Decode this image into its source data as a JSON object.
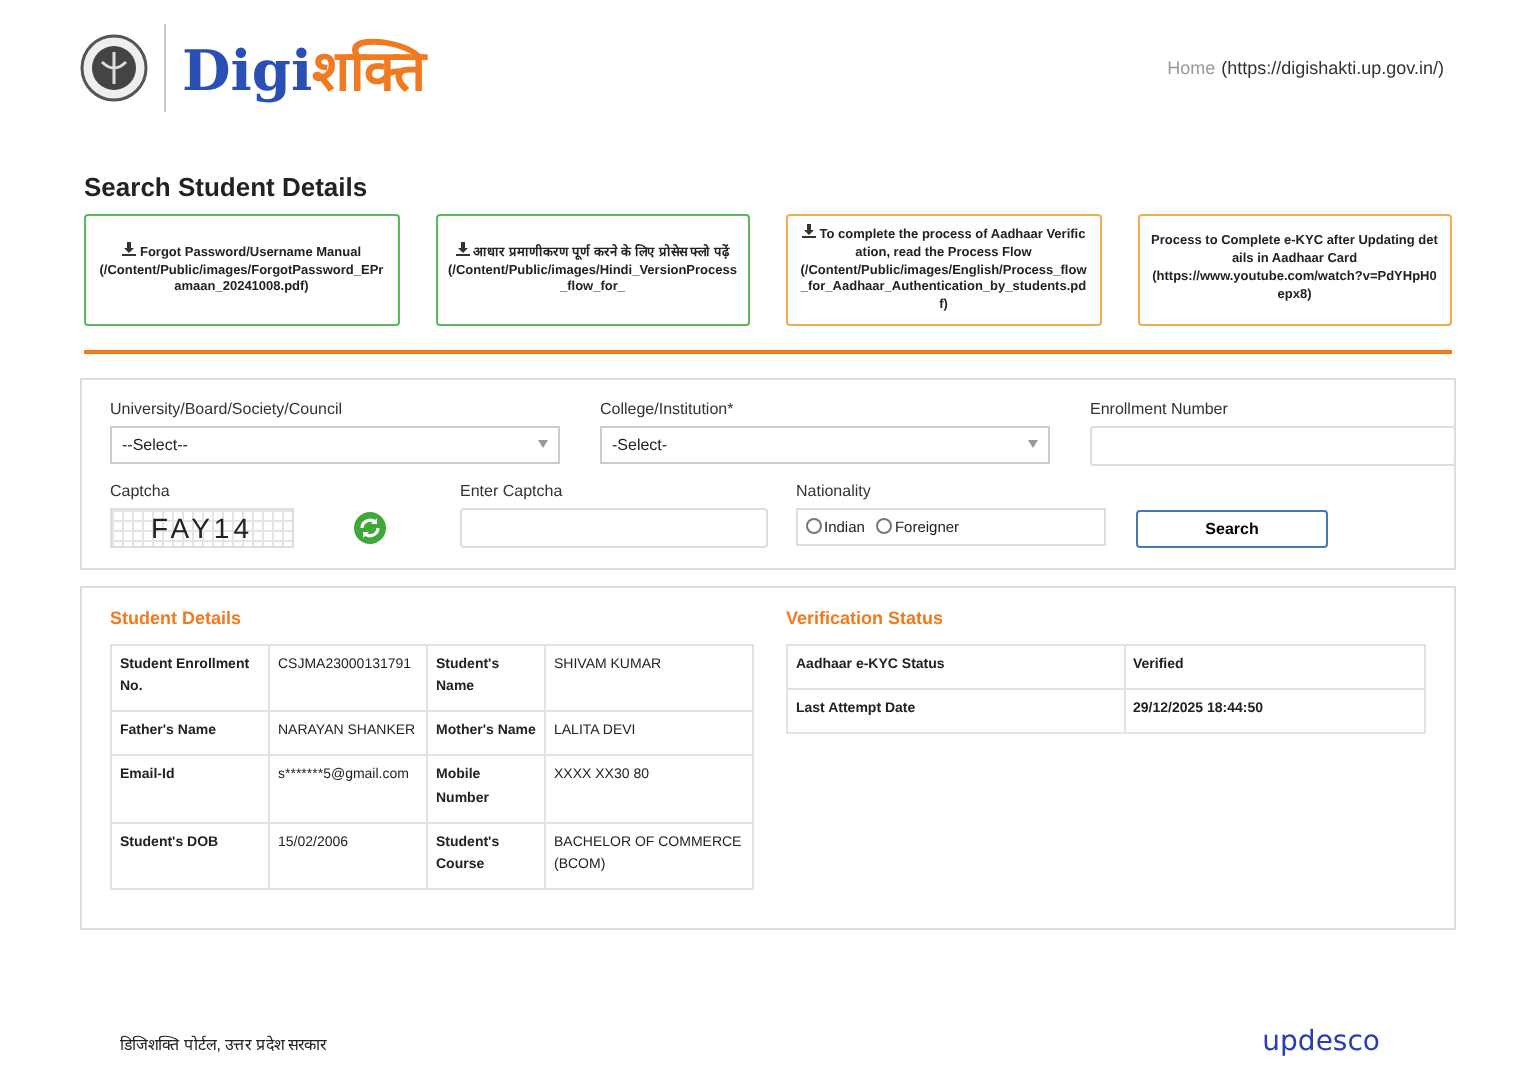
{
  "header": {
    "logo_text": "Digi",
    "logo_text_hindi": "शक्ति",
    "nav": [
      {
        "label": "Home",
        "url": "(https://digishakti.up.gov.in/)"
      }
    ]
  },
  "page_title": "Search Student Details",
  "links": [
    {
      "color": "#5cb85c",
      "title": "Forgot Password/Username Manual",
      "url": "(/Content/Public/images/ForgotPassword_EPramaan_20241008.pdf)",
      "icon": true
    },
    {
      "color": "#5cb85c",
      "title": "आधार प्रमाणीकरण पूर्ण करने के लिए प्रोसेस फ्लो पढ़ें",
      "url": "(/Content/Public/images/Hindi_VersionProcess_flow_for_",
      "icon": true
    },
    {
      "color": "#f0ad4e",
      "title": "To complete the process of Aadhaar Verification, read the Process Flow",
      "url": "(/Content/Public/images/English/Process_flow_for_Aadhaar_Authentication_by_students.pdf)",
      "icon": true
    },
    {
      "color": "#f0ad4e",
      "title": "Process to Complete e-KYC after Updating details in Aadhaar Card",
      "url": "(https://www.youtube.com/watch?v=PdYHpH0epx8)",
      "icon": false
    }
  ],
  "form": {
    "fields": [
      {
        "kind": "select",
        "label": "University/Board/Society/Council",
        "value": "--Select--"
      },
      {
        "kind": "select",
        "label": "College/Institution*",
        "value": "-Select-"
      },
      {
        "kind": "input",
        "label": "Enrollment Number"
      },
      {
        "kind": "captcha",
        "label": "Captcha",
        "value": "FAY14"
      },
      {
        "kind": "input",
        "label": "Enter Captcha"
      },
      {
        "kind": "radio",
        "label": "Nationality",
        "options": [
          {
            "label": "Indian",
            "selected": false
          },
          {
            "label": "Foreigner",
            "selected": false
          }
        ]
      },
      {
        "kind": "button",
        "label": "Search"
      }
    ]
  },
  "student_details": {
    "title": "Student Details",
    "rows": [
      [
        "Student Enrollment No.",
        "CSJMA23000131791",
        "Student's Name",
        "SHIVAM KUMAR"
      ],
      [
        "Father's Name",
        "NARAYAN SHANKER",
        "Mother's Name",
        "LALITA DEVI"
      ],
      [
        "Email-Id",
        "s*******5@gmail.com",
        "Mobile Number",
        "XXXX XX30 80"
      ],
      [
        "Student's DOB",
        "15/02/2006",
        "Student's Course",
        "BACHELOR OF COMMERCE (BCOM)"
      ]
    ]
  },
  "verification_status": {
    "title": "Verification Status",
    "rows": [
      [
        "Aadhaar e-KYC Status",
        "Verified"
      ],
      [
        "Last Attempt Date",
        "29/12/2025 18:44:50"
      ]
    ]
  },
  "footer": {
    "text": "डिजिशक्ति पोर्टल, उत्तर प्रदेश सरकार",
    "logo": "updesco"
  }
}
